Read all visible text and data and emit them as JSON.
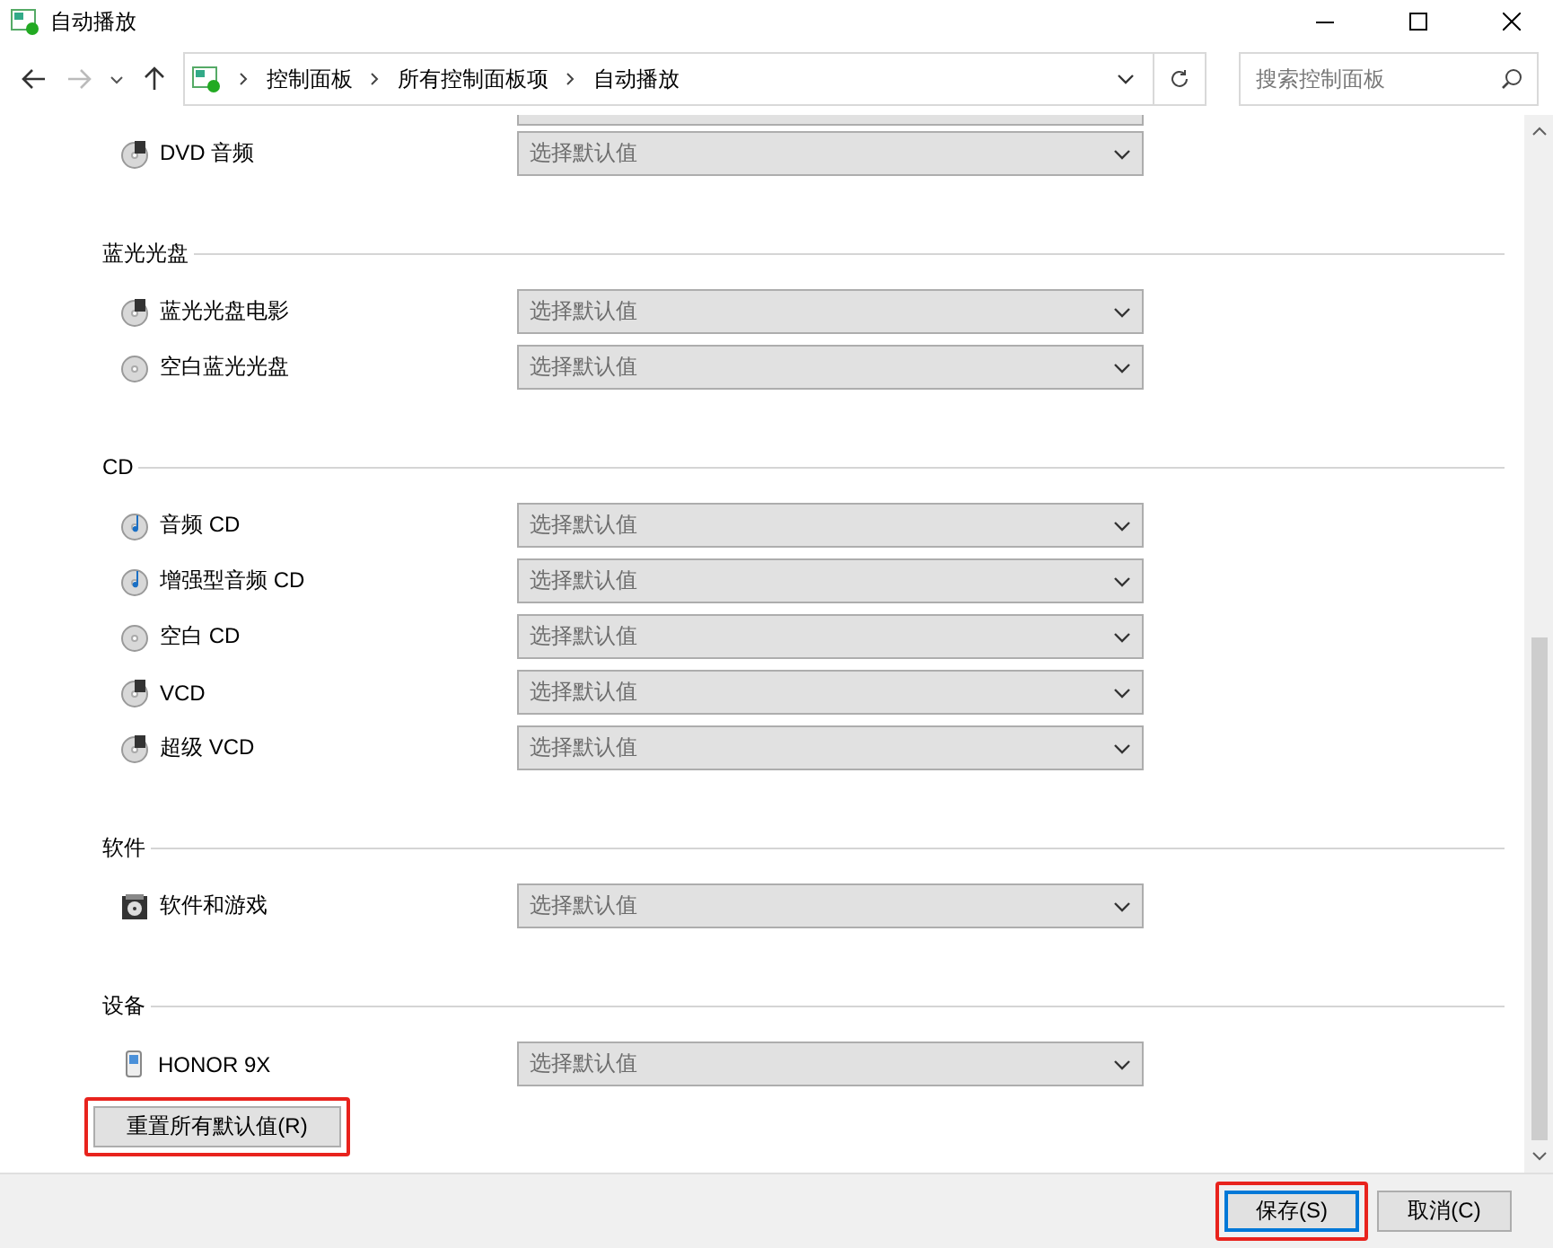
{
  "window": {
    "title": "自动播放"
  },
  "address": {
    "path": [
      "控制面板",
      "所有控制面板项",
      "自动播放"
    ],
    "search_placeholder": "搜索控制面板"
  },
  "sections": [
    {
      "items": [
        {
          "label": "DVD 音频",
          "kind": "film",
          "value": "选择默认值"
        }
      ]
    },
    {
      "title": "蓝光光盘",
      "items": [
        {
          "label": "蓝光光盘电影",
          "kind": "film",
          "value": "选择默认值"
        },
        {
          "label": "空白蓝光光盘",
          "kind": "blank",
          "value": "选择默认值"
        }
      ]
    },
    {
      "title": "CD",
      "items": [
        {
          "label": "音频 CD",
          "kind": "music",
          "value": "选择默认值"
        },
        {
          "label": "增强型音频 CD",
          "kind": "music",
          "value": "选择默认值"
        },
        {
          "label": "空白 CD",
          "kind": "blank",
          "value": "选择默认值"
        },
        {
          "label": "VCD",
          "kind": "film",
          "value": "选择默认值"
        },
        {
          "label": "超级 VCD",
          "kind": "film",
          "value": "选择默认值"
        }
      ]
    },
    {
      "title": "软件",
      "items": [
        {
          "label": "软件和游戏",
          "kind": "software",
          "value": "选择默认值"
        }
      ]
    },
    {
      "title": "设备",
      "items": [
        {
          "label": "HONOR 9X",
          "kind": "phone",
          "value": "选择默认值"
        }
      ]
    }
  ],
  "reset_button": {
    "label": "重置所有默认值(R)",
    "highlighted": true
  },
  "footer_buttons": [
    {
      "label": "保存(S)",
      "focused": true,
      "highlighted": true
    },
    {
      "label": "取消(C)",
      "focused": false,
      "highlighted": false
    }
  ]
}
